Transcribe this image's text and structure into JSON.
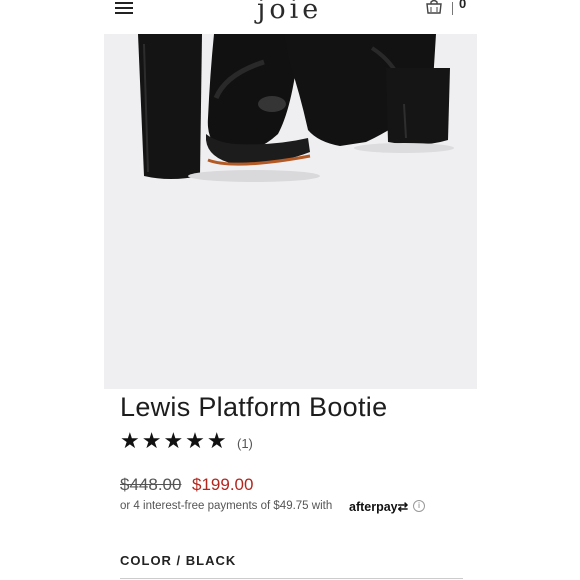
{
  "header": {
    "logo_text": "JOIE",
    "cart_count": "0",
    "icons": [
      "menu-icon",
      "shopping-bag-icon"
    ]
  },
  "product": {
    "title": "Lewis Platform Bootie",
    "stars": "★★★★★",
    "rating": 5,
    "review_count": "(1)",
    "original_price": "$448.00",
    "sale_price": "$199.00",
    "installment_text": "or 4 interest-free payments of $49.75 with",
    "afterpay_label": "afterpay",
    "info_glyph": "i",
    "color_label": "COLOR / BLACK"
  },
  "colors": {
    "sale": "#b3261e",
    "text": "#1d1d1d",
    "image_bg": "#efeff1",
    "boot": "#141414"
  }
}
